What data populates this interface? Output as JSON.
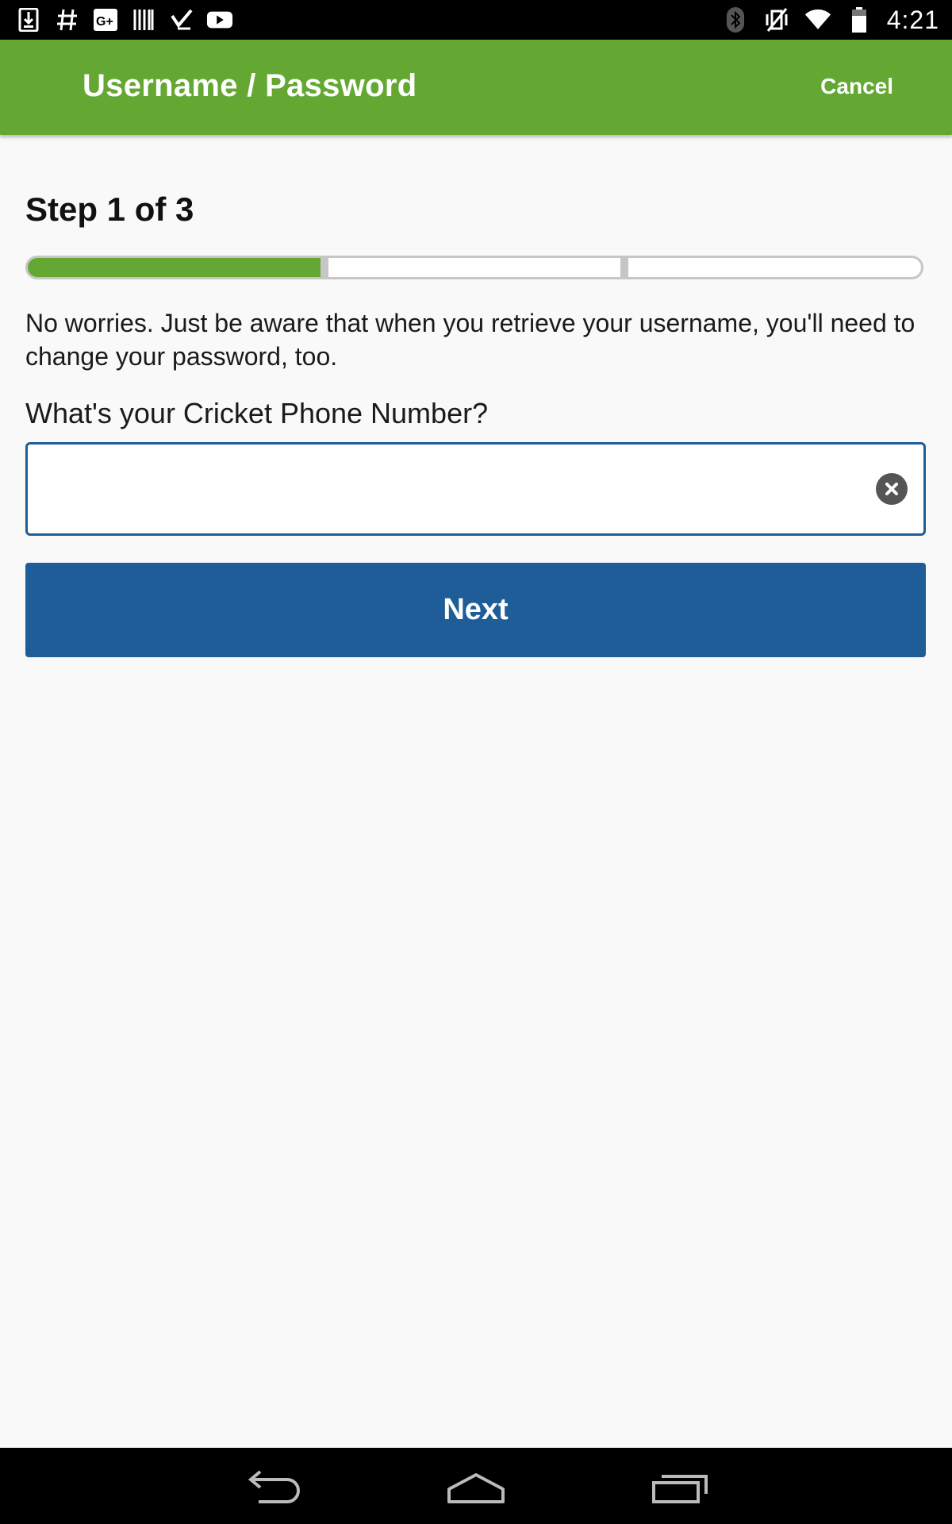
{
  "status_bar": {
    "time": "4:21",
    "left_icons": [
      "download-icon",
      "hash-icon",
      "google-plus-icon",
      "barcode-icon",
      "check-tasks-icon",
      "youtube-icon"
    ],
    "right_icons": [
      "bluetooth-icon",
      "vibrate-off-icon",
      "wifi-icon",
      "battery-icon"
    ]
  },
  "header": {
    "title": "Username / Password",
    "cancel_label": "Cancel",
    "color": "#64a833"
  },
  "form": {
    "step_label": "Step 1 of 3",
    "progress": {
      "current_step": 1,
      "total_steps": 3
    },
    "info_text": "No worries. Just be aware that when you retrieve your username, you'll need to change your password, too.",
    "phone_label": "What's your Cricket Phone Number?",
    "phone_value": "",
    "next_label": "Next",
    "accent_color": "#1f5d99"
  },
  "nav_bar": {
    "buttons": [
      "back-icon",
      "home-icon",
      "recent-apps-icon"
    ]
  }
}
